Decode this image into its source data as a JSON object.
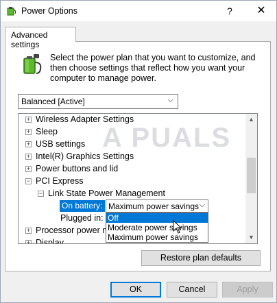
{
  "window": {
    "title": "Power Options",
    "help_label": "?",
    "close_label": "✕"
  },
  "tabs": [
    {
      "label": "Advanced settings"
    }
  ],
  "description": "Select the power plan that you want to customize, and then choose settings that reflect how you want your computer to manage power.",
  "plan_select": {
    "value": "Balanced [Active]"
  },
  "watermark": "A  PUALS",
  "tree": {
    "items": [
      {
        "label": "Wireless Adapter Settings",
        "expander": "+"
      },
      {
        "label": "Sleep",
        "expander": "+"
      },
      {
        "label": "USB settings",
        "expander": "+"
      },
      {
        "label": "Intel(R) Graphics Settings",
        "expander": "+"
      },
      {
        "label": "Power buttons and lid",
        "expander": "+"
      },
      {
        "label": "PCI Express",
        "expander": "−"
      },
      {
        "label": "Link State Power Management",
        "expander": "−"
      },
      {
        "label": "Processor power m",
        "expander": "+"
      },
      {
        "label": "Display",
        "expander": "+"
      }
    ],
    "on_battery": {
      "label": "On battery:",
      "value": "Maximum power savings"
    },
    "plugged_in": {
      "label": "Plugged in:"
    },
    "dropdown_options": [
      "Off",
      "Moderate power savings",
      "Maximum power savings"
    ],
    "selected_option": "Off"
  },
  "buttons": {
    "restore": "Restore plan defaults",
    "ok": "OK",
    "cancel": "Cancel",
    "apply": "Apply"
  },
  "colors": {
    "accent": "#0078d7",
    "battery_green": "#5cb82c"
  }
}
